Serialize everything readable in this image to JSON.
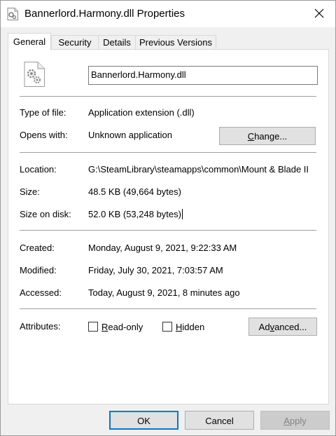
{
  "window": {
    "title": "Bannerlord.Harmony.dll Properties",
    "title_icon": "dll-file-icon",
    "close_icon": "close-icon"
  },
  "tabs": [
    {
      "label": "General",
      "active": true
    },
    {
      "label": "Security",
      "active": false
    },
    {
      "label": "Details",
      "active": false
    },
    {
      "label": "Previous Versions",
      "active": false
    }
  ],
  "general": {
    "file_icon": "gear-file-icon",
    "file_name": "Bannerlord.Harmony.dll",
    "type_label": "Type of file:",
    "type_value": "Application extension (.dll)",
    "opens_label": "Opens with:",
    "opens_value": "Unknown application",
    "change_button": {
      "prefix": "C",
      "rest": "hange..."
    },
    "location_label": "Location:",
    "location_value": "G:\\SteamLibrary\\steamapps\\common\\Mount & Blade II",
    "size_label": "Size:",
    "size_value": "48.5 KB (49,664 bytes)",
    "size_on_disk_label": "Size on disk:",
    "size_on_disk_value": "52.0 KB (53,248 bytes)",
    "created_label": "Created:",
    "created_value": "Monday, August 9, 2021, 9:22:33 AM",
    "modified_label": "Modified:",
    "modified_value": "Friday, July 30, 2021, 7:03:57 AM",
    "accessed_label": "Accessed:",
    "accessed_value": "Today, August 9, 2021, 8 minutes ago",
    "attributes_label": "Attributes:",
    "readonly": {
      "prefix": "R",
      "rest": "ead-only",
      "checked": false
    },
    "hidden": {
      "prefix": "H",
      "rest": "idden",
      "checked": false
    },
    "advanced_button": {
      "prefix": "Ad",
      "u": "v",
      "rest": "anced..."
    }
  },
  "footer": {
    "ok": "OK",
    "cancel": "Cancel",
    "apply": {
      "prefix": "",
      "u": "A",
      "rest": "pply",
      "enabled": false
    }
  }
}
